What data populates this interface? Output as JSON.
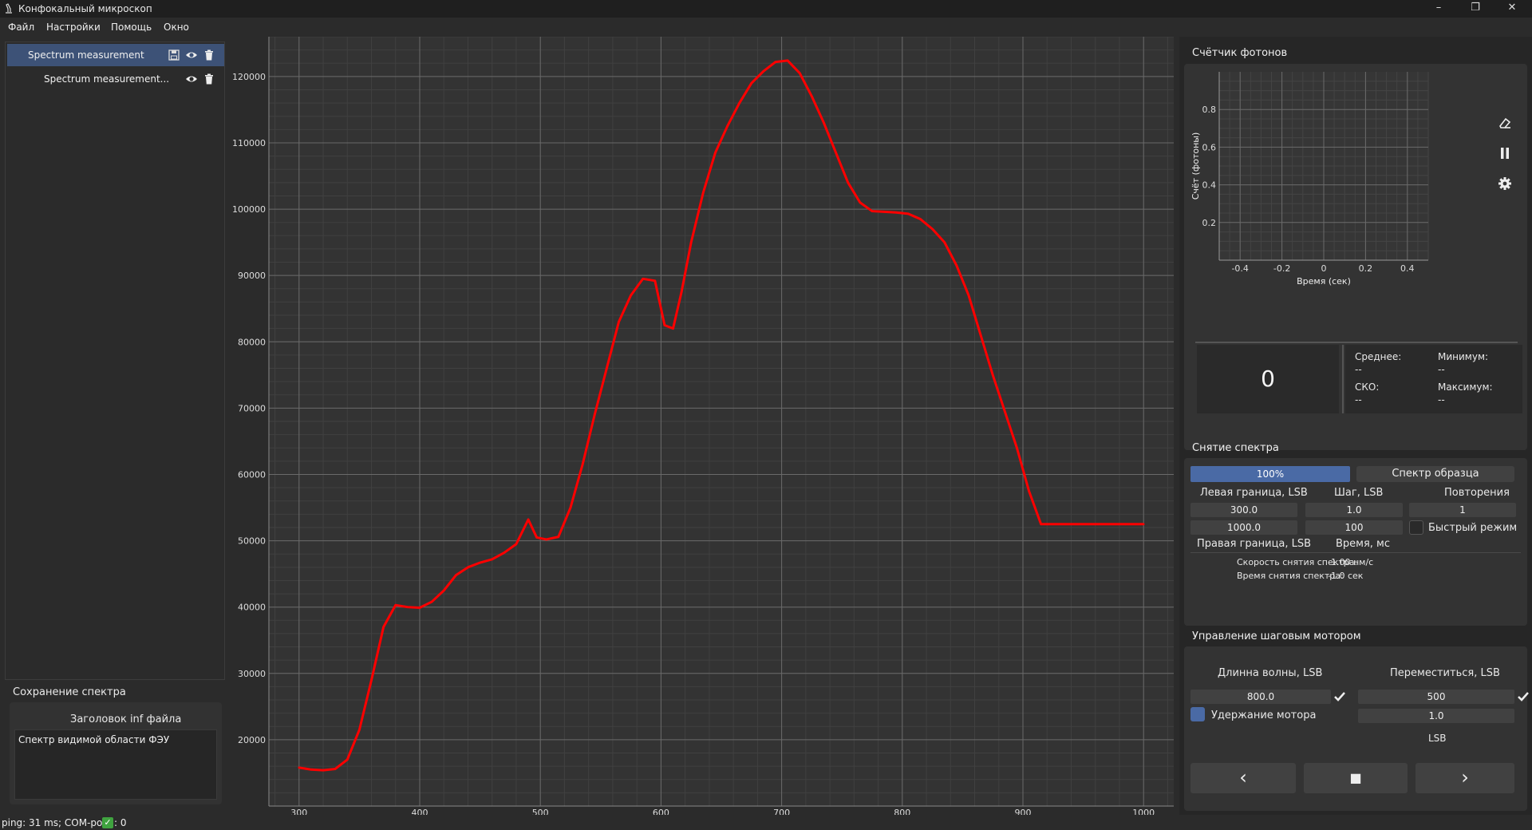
{
  "window": {
    "title": "Конфокальный микроскоп",
    "minimize": "–",
    "maximize": "❐",
    "close": "✕"
  },
  "menu": [
    "Файл",
    "Настройки",
    "Помощь",
    "Окно"
  ],
  "measurements": [
    {
      "label": "Spectrum measurement",
      "selected": true
    },
    {
      "label": "Spectrum measurement...",
      "selected": false
    }
  ],
  "save": {
    "title": "Сохранение спектра",
    "header_label": "Заголовок inf файла",
    "header_value": "Спектр видимой области ФЭУ"
  },
  "photon_counter": {
    "title": "Счётчик фотонов",
    "xlabel": "Время (сек)",
    "ylabel": "Счёт (фотоны)",
    "x_ticks": [
      "-0.4",
      "-0.2",
      "0",
      "0.2",
      "0.4"
    ],
    "y_ticks": [
      "0.2",
      "0.4",
      "0.6",
      "0.8"
    ],
    "value": "0",
    "stats": {
      "mean_label": "Среднее:",
      "mean": "--",
      "min_label": "Минимум:",
      "min": "--",
      "sko_label": "СКО:",
      "sko": "--",
      "max_label": "Максимум:",
      "max": "--"
    }
  },
  "spectrum": {
    "title": "Снятие спектра",
    "progress_label": "100%",
    "progress": 1.0,
    "sample_button": "Спектр образца",
    "left_label": "Левая граница, LSB",
    "step_label": "Шаг, LSB",
    "repeat_label": "Повторения",
    "left_value": "300.0",
    "step_value": "1.0",
    "repeat_value": "1",
    "right_value": "1000.0",
    "time_value": "100",
    "fast_mode_label": "Быстрый режим",
    "right_label": "Правая граница, LSB",
    "time_label": "Время, мс",
    "speed_label": "Скорость снятия спектра:",
    "speed_value": "-1.00 нм/с",
    "duration_label": "Время снятия спектра:",
    "duration_value": "-1.0 сек"
  },
  "motor": {
    "title": "Управление шаговым мотором",
    "wavelength_label": "Длинна волны, LSB",
    "move_label": "Переместиться, LSB",
    "wavelength_value": "800.0",
    "move_value": "500",
    "hold_label": "Удержание мотора",
    "step_value": "1.0",
    "unit_label": "LSB",
    "prev": "‹",
    "stop": "■",
    "next": "›"
  },
  "status": {
    "text": "ping: 31 ms; COM-port",
    "suffix": ": 0"
  },
  "colors": {
    "accent": "#4a6aa5",
    "curve": "#ff0000",
    "raw": "#ffffff",
    "selected": "#3d5277"
  },
  "chart_data": {
    "type": "line",
    "title": "",
    "xlabel": "",
    "ylabel": "",
    "xlim": [
      275,
      1025
    ],
    "ylim": [
      10000,
      126000
    ],
    "x_ticks": [
      300,
      400,
      500,
      600,
      700,
      800,
      900,
      1000
    ],
    "y_ticks": [
      20000,
      30000,
      40000,
      50000,
      60000,
      70000,
      80000,
      90000,
      100000,
      110000,
      120000
    ],
    "grid": true,
    "series": [
      {
        "x": [
          300,
          310,
          320,
          330,
          340,
          350,
          360,
          370,
          380,
          390,
          400,
          410,
          420,
          430,
          440,
          450,
          460,
          470,
          480,
          490,
          497,
          505,
          515,
          525,
          535,
          545,
          555,
          565,
          575,
          585,
          595,
          603,
          610,
          617,
          625,
          635,
          645,
          655,
          665,
          675,
          685,
          695,
          705,
          715,
          725,
          735,
          745,
          755,
          765,
          775,
          785,
          795,
          805,
          815,
          825,
          835,
          845,
          855,
          865,
          875,
          885,
          895,
          905,
          915,
          925,
          935,
          945,
          955,
          965,
          975,
          985,
          995,
          1000
        ],
        "y": [
          15800,
          15500,
          15400,
          15600,
          17000,
          21500,
          29000,
          37000,
          40300,
          40000,
          39900,
          40800,
          42500,
          44800,
          46000,
          46700,
          47200,
          48200,
          49500,
          53200,
          50500,
          50200,
          50600,
          55000,
          61500,
          69000,
          76000,
          83000,
          87000,
          89500,
          89200,
          82500,
          82000,
          87500,
          95000,
          102500,
          108500,
          112500,
          116000,
          119000,
          120800,
          122200,
          122400,
          120500,
          117000,
          113000,
          108500,
          104000,
          101000,
          99700,
          99600,
          99500,
          99300,
          98500,
          97000,
          95000,
          91500,
          87000,
          81000,
          75000,
          69500,
          64000,
          57500,
          52500,
          52500,
          52500,
          52500,
          52500,
          52500,
          52500,
          52500,
          52500,
          52500
        ],
        "color": "#ff0000"
      }
    ]
  }
}
